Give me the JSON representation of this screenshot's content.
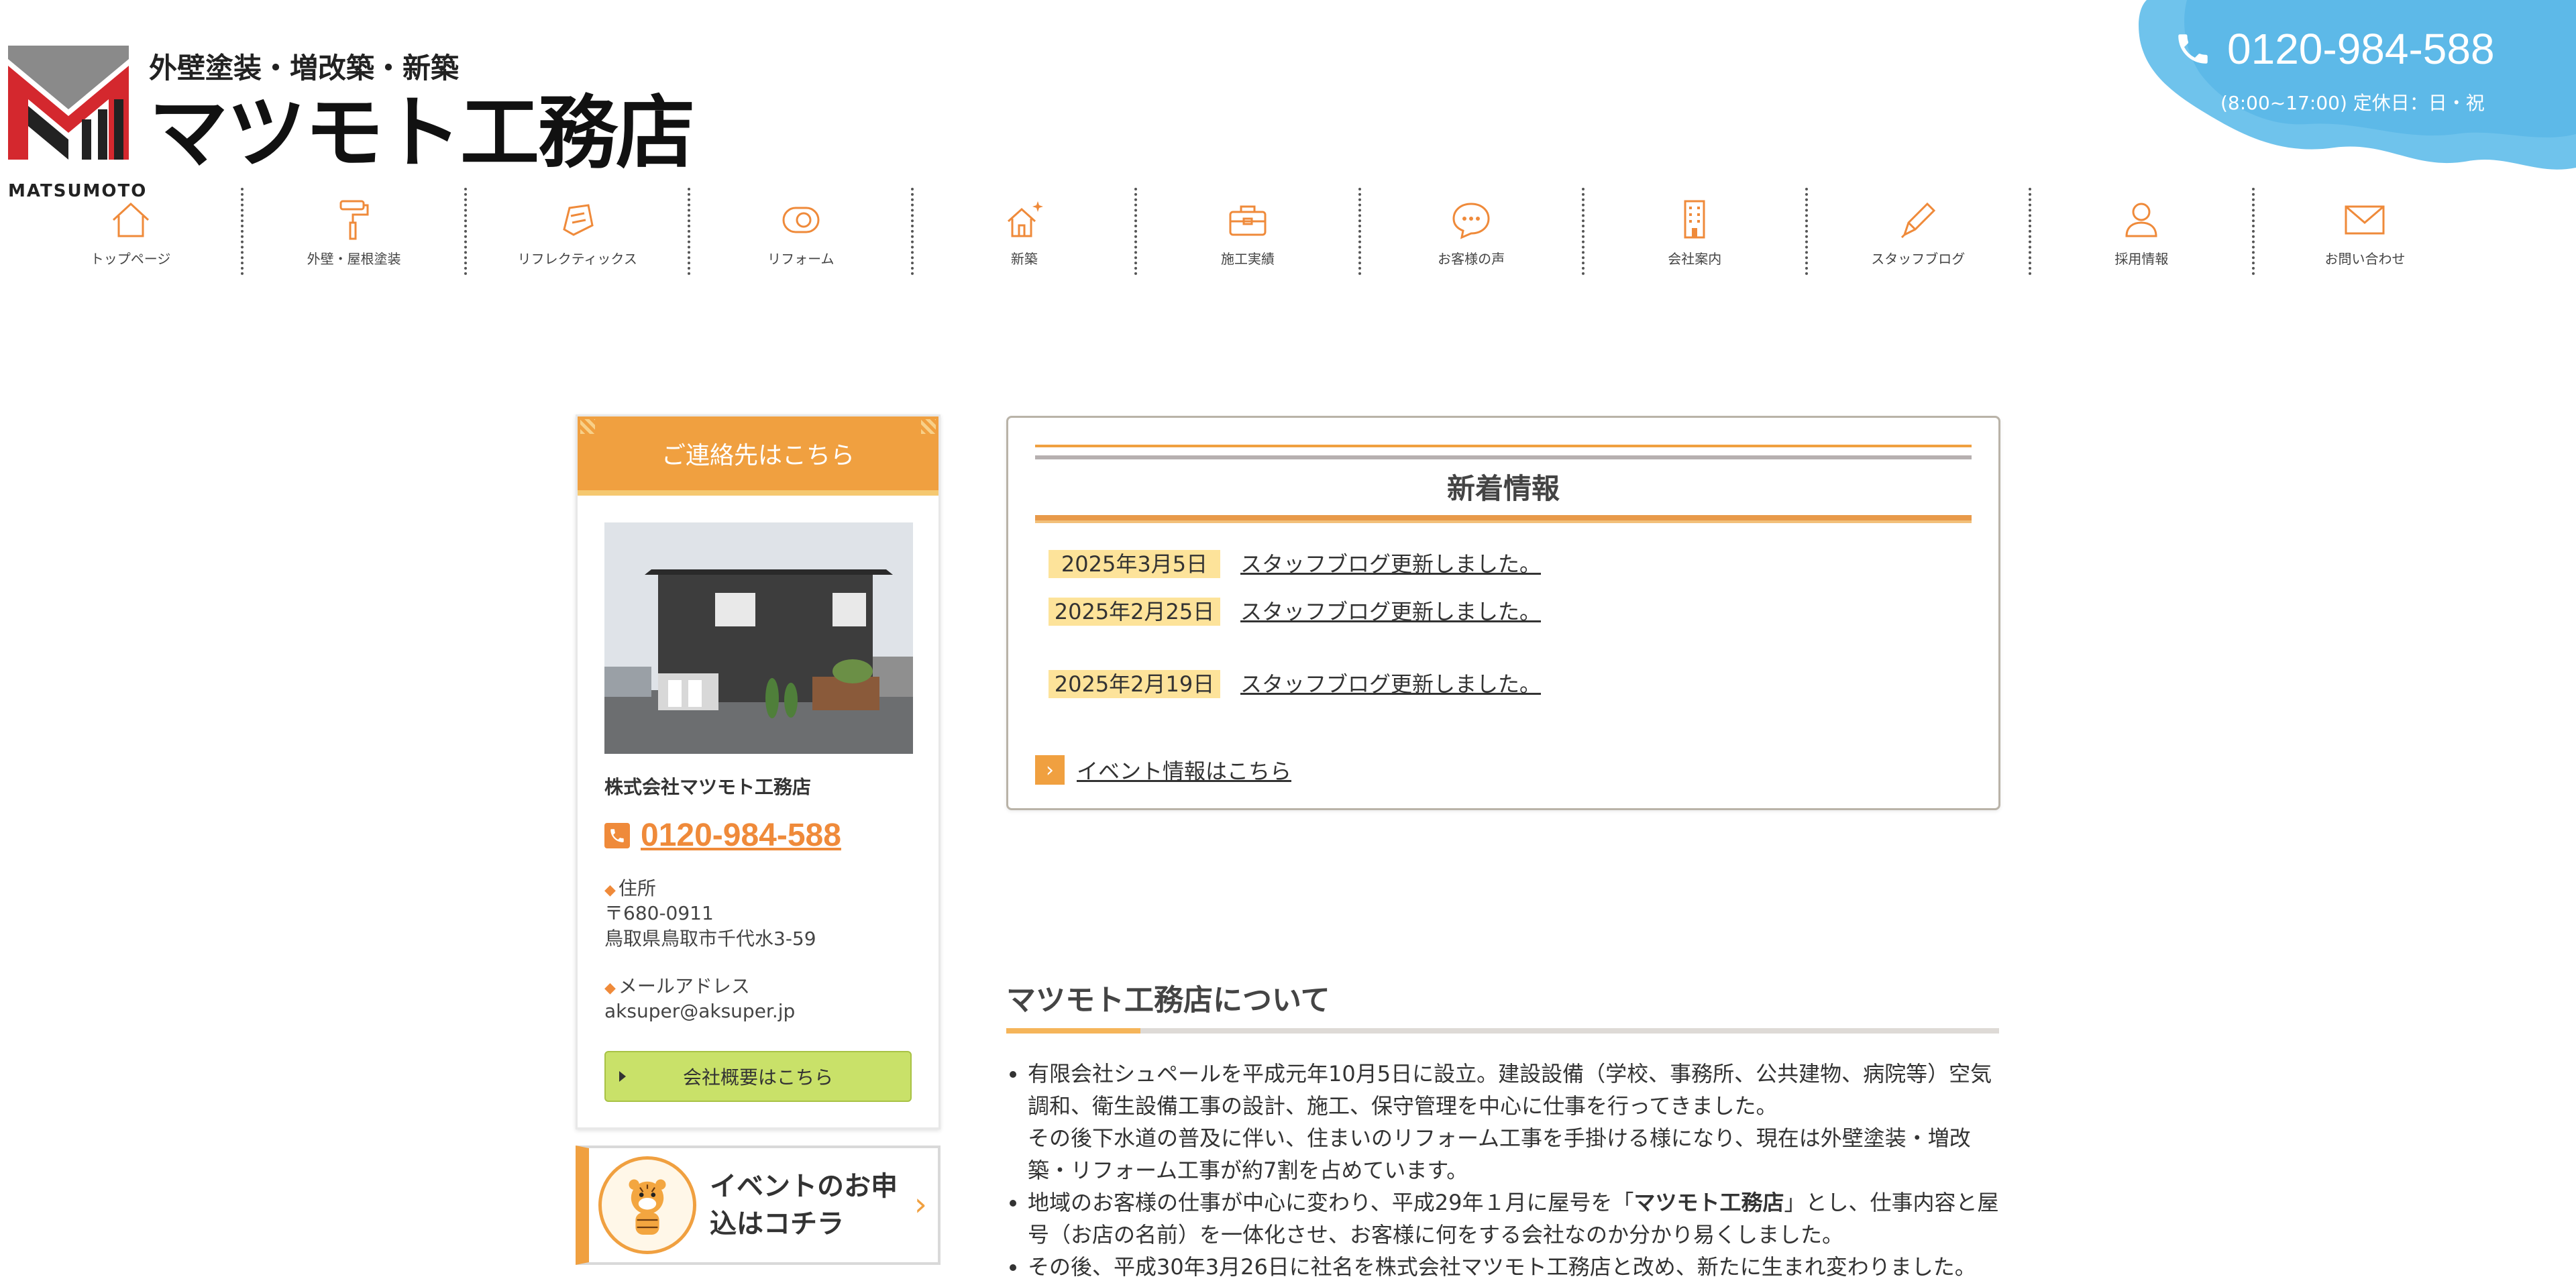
{
  "header": {
    "tagline": "外壁塗装・増改築・新築",
    "company_name": "マツモト工務店",
    "logo_en": "MATSUMOTO",
    "phone": "0120-984-588",
    "hours": "(8:00~17:00) 定休日：日・祝"
  },
  "nav": {
    "items": [
      {
        "label": "トップページ",
        "icon": "home-icon"
      },
      {
        "label": "外壁・屋根塗装",
        "icon": "paint-roller-icon"
      },
      {
        "label": "リフレクティックス",
        "icon": "insulation-icon"
      },
      {
        "label": "リフォーム",
        "icon": "reform-icon"
      },
      {
        "label": "新築",
        "icon": "new-house-icon"
      },
      {
        "label": "施工実績",
        "icon": "toolbox-icon"
      },
      {
        "label": "お客様の声",
        "icon": "chat-bubble-icon"
      },
      {
        "label": "会社案内",
        "icon": "building-icon"
      },
      {
        "label": "スタッフブログ",
        "icon": "pen-icon"
      },
      {
        "label": "採用情報",
        "icon": "person-icon"
      },
      {
        "label": "お問い合わせ",
        "icon": "mail-icon"
      }
    ]
  },
  "sidebar": {
    "contact_heading": "ご連絡先はこちら",
    "company": "株式会社マツモト工務店",
    "phone": "0120-984-588",
    "address_label": "住所",
    "postal": "〒680-0911",
    "address": "鳥取県鳥取市千代水3-59",
    "email_label": "メールアドレス",
    "email": "aksuper@aksuper.jp",
    "overview_button": "会社概要はこちら",
    "event_banner": "イベントのお申込はコチラ"
  },
  "news": {
    "title": "新着情報",
    "items": [
      {
        "date": "2025年3月5日",
        "text": "スタッフブログ更新しました。"
      },
      {
        "date": "2025年2月25日",
        "text": "スタッフブログ更新しました。"
      },
      {
        "date": "2025年2月19日",
        "text": "スタッフブログ更新しました。"
      }
    ],
    "event_link": "イベント情報はこちら"
  },
  "about": {
    "title": "マツモト工務店について",
    "p1": "有限会社シュペールを平成元年10月5日に設立。建設設備（学校、事務所、公共建物、病院等）空気調和、衛生設備工事の設計、施工、保守管理を中心に仕事を行ってきました。",
    "p1b": "その後下水道の普及に伴い、住まいのリフォーム工事を手掛ける様になり、現在は外壁塗装・増改築・リフォーム工事が約7割を占めています。",
    "p2a": "地域のお客様の仕事が中心に変わり、平成29年１月に屋号を「",
    "p2bold": "マツモト工務店",
    "p2b": "」とし、仕事内容と屋号（お店の名前）を一体化させ、お客様に何をする会社なのか分かり易くしました。",
    "p3": "その後、平成30年3月26日に社名を株式会社マツモト工務店と改め、新たに生まれ変わりました。"
  },
  "colors": {
    "accent_orange": "#f0a040",
    "phone_blue": "#5bb8e8",
    "button_green": "#c9e169",
    "date_yellow": "#fde39a",
    "logo_red": "#d4282e"
  }
}
